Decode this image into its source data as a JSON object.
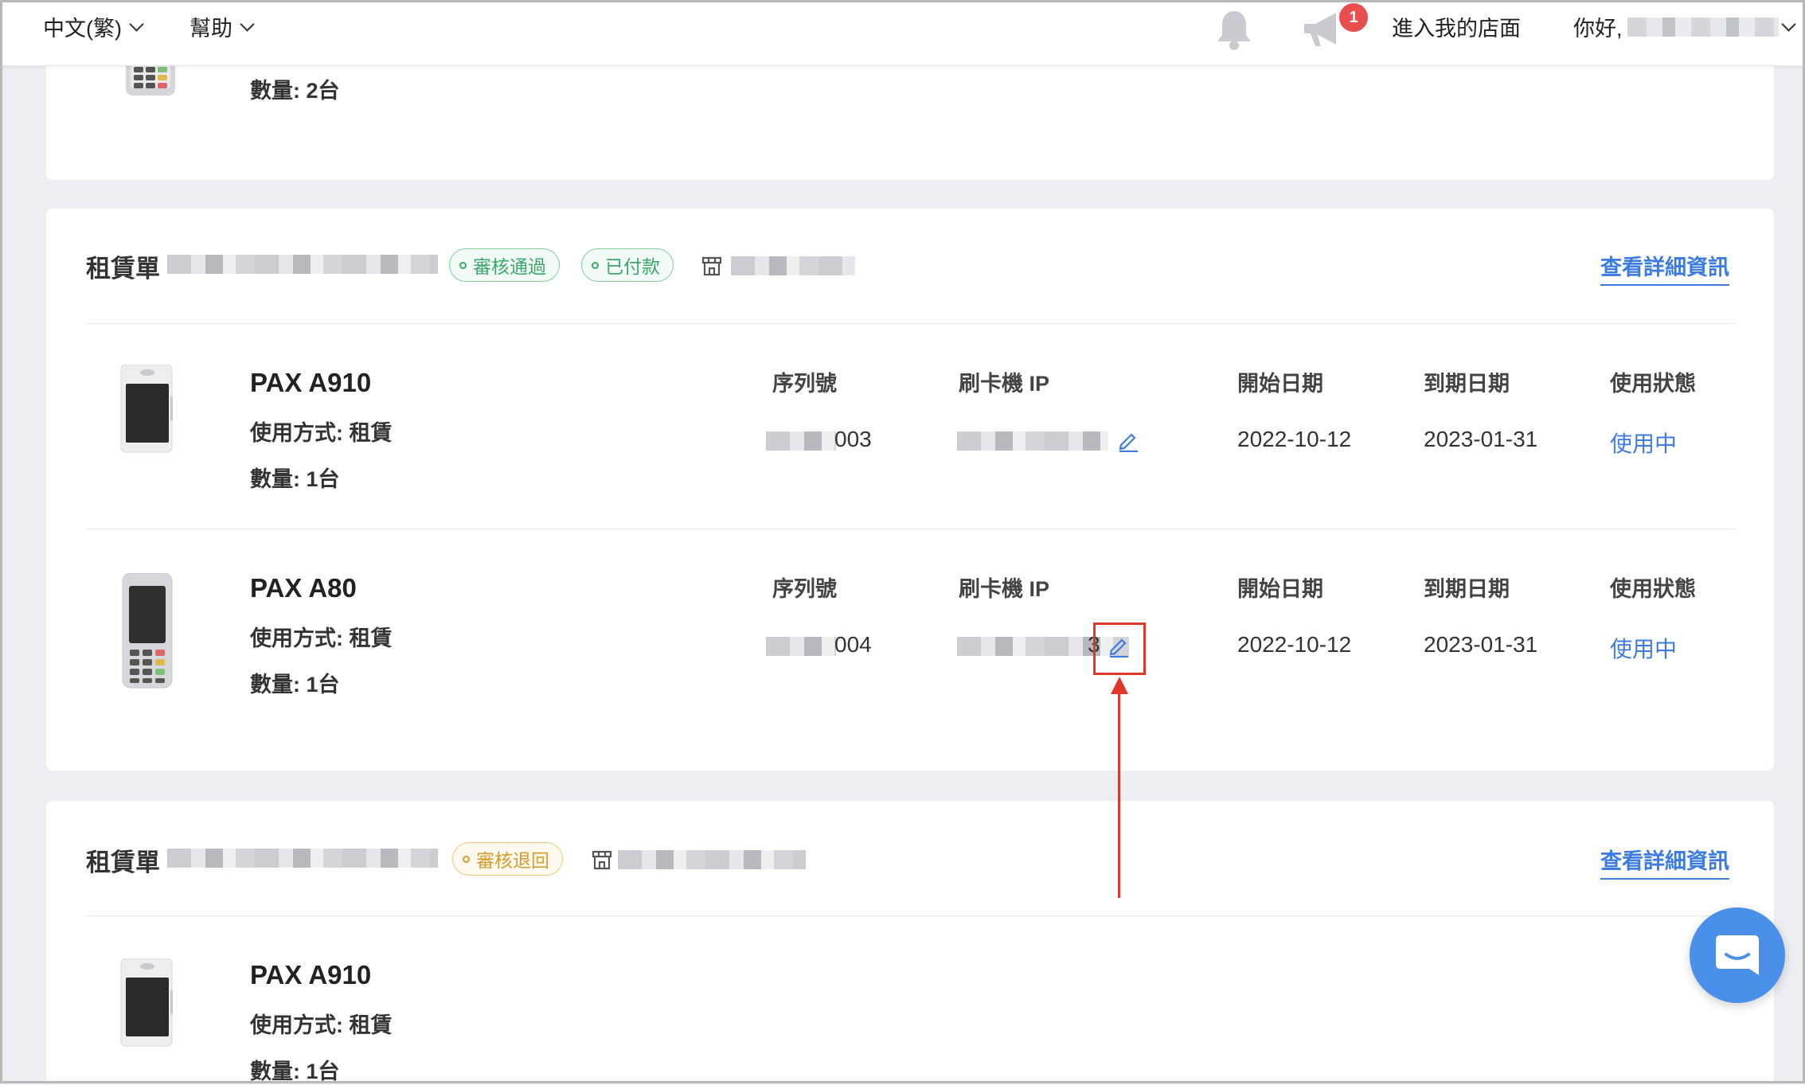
{
  "topbar": {
    "language": "中文(繁)",
    "help": "幫助",
    "notification_count": "1",
    "store_link": "進入我的店面",
    "greeting": "你好,"
  },
  "card_top": {
    "quantity": "數量: 2台"
  },
  "order1": {
    "title": "租賃單",
    "tag_review": "審核通過",
    "tag_paid": "已付款",
    "detail_link": "查看詳細資訊",
    "items": [
      {
        "name": "PAX A910",
        "usage": "使用方式: 租賃",
        "quantity": "數量: 1台",
        "serial_label": "序列號",
        "ip_label": "刷卡機 IP",
        "start_label": "開始日期",
        "end_label": "到期日期",
        "status_label": "使用狀態",
        "serial": "003",
        "start": "2022-10-12",
        "end": "2023-01-31",
        "status": "使用中"
      },
      {
        "name": "PAX A80",
        "usage": "使用方式: 租賃",
        "quantity": "數量: 1台",
        "serial_label": "序列號",
        "ip_label": "刷卡機 IP",
        "start_label": "開始日期",
        "end_label": "到期日期",
        "status_label": "使用狀態",
        "serial": "004",
        "ip_suffix": "3",
        "start": "2022-10-12",
        "end": "2023-01-31",
        "status": "使用中"
      }
    ]
  },
  "order2": {
    "title": "租賃單",
    "tag_review": "審核退回",
    "detail_link": "查看詳細資訊",
    "items": [
      {
        "name": "PAX A910",
        "usage": "使用方式: 租賃",
        "quantity": "數量: 1台"
      }
    ]
  },
  "colors": {
    "accent": "#3d7be0",
    "tag_green": "#3aa86b",
    "tag_orange": "#d99a2b",
    "highlight": "#e0372a",
    "chat": "#4a8fea"
  }
}
